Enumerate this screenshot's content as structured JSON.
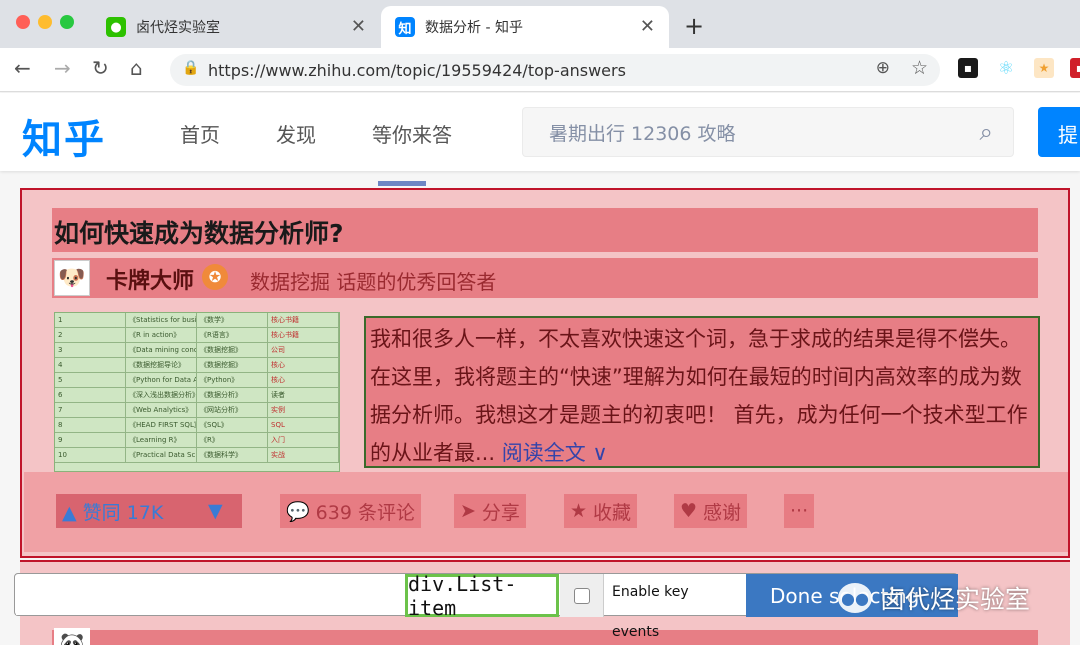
{
  "browser": {
    "tabs": [
      {
        "title": "卤代烃实验室",
        "favicon_color": "#2dc100",
        "favicon_glyph": "●",
        "active": false
      },
      {
        "title": "数据分析 - 知乎",
        "favicon_color": "#0084ff",
        "favicon_glyph": "知",
        "active": true
      }
    ],
    "new_tab": "+",
    "url": "https://www.zhihu.com/topic/19559424/top-answers",
    "icons": [
      "back-icon",
      "forward-icon",
      "reload-icon",
      "home-icon",
      "lock-icon",
      "zoom-icon",
      "bookmark-star-icon"
    ],
    "extensions": [
      {
        "name": "extension-1-icon",
        "color": "#1a1a1a",
        "glyph": "▪"
      },
      {
        "name": "react-devtools-icon",
        "color": "#61dafb",
        "glyph": "⚛"
      },
      {
        "name": "extension-3-icon",
        "color": "#f0a030",
        "glyph": "★"
      },
      {
        "name": "extension-4-icon",
        "color": "#d0202a",
        "glyph": "▪"
      }
    ]
  },
  "zhihu": {
    "logo": "知乎",
    "nav": [
      "首页",
      "发现",
      "等你来答"
    ],
    "search_placeholder": "暑期出行 12306 攻略",
    "ask_button": "提",
    "brand_color": "#0084ff"
  },
  "answer": {
    "question_title": "如何快速成为数据分析师?",
    "author_name": "卡牌大师",
    "author_badge": "✪",
    "author_desc": "数据挖掘 话题的优秀回答者",
    "excerpt": "我和很多人一样，不太喜欢快速这个词，急于求成的结果是得不偿失。 在这里，我将题主的“快速”理解为如何在最短的时间内高效率的成为数据分析师。我想这才是题主的初衷吧！ 首先，成为任何一个技术型工作的从业者最...",
    "read_more": "阅读全文",
    "read_more_icon": "∨",
    "vote_label": "▲ 赞同 17K",
    "vote_down": "▼",
    "comments": "639 条评论",
    "share": "分享",
    "collect": "收藏",
    "thanks": "感谢",
    "more": "···"
  },
  "selector_gadget": {
    "input_value": "",
    "selector": "div.List-item",
    "enable_key_label_1": "Enable key",
    "enable_key_label_2": "events",
    "done_label": "Done selecting",
    "highlight_color": "#c0142a",
    "selector_border_color": "#6cc24a"
  },
  "watermark": {
    "text": "卤代烃实验室",
    "icon": "wechat-icon"
  }
}
